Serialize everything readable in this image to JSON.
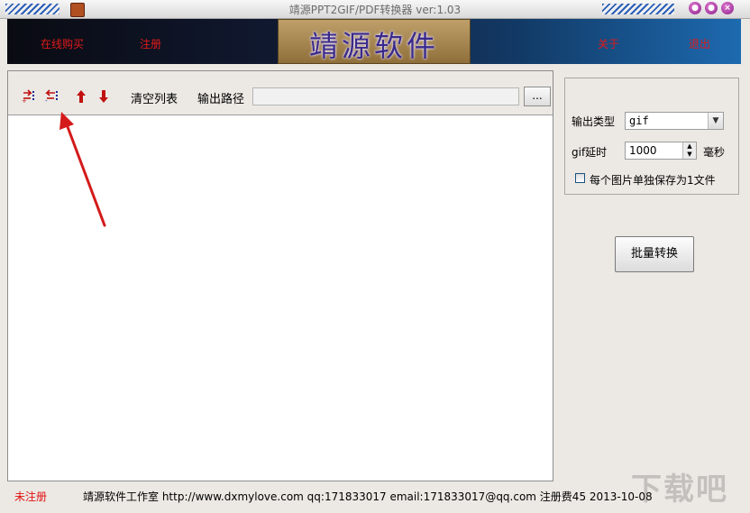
{
  "window": {
    "title": "靖源PPT2GIF/PDF转换器 ver:1.03",
    "min_glyph": "●",
    "max_glyph": "●",
    "close_glyph": "×"
  },
  "banner": {
    "buy_online": "在线购买",
    "register": "注册",
    "logo": "靖源软件",
    "about": "关于",
    "exit": "退出"
  },
  "toolbar": {
    "clear_list": "清空列表",
    "output_path_label": "输出路径",
    "output_path_value": "",
    "browse_label": "..."
  },
  "options": {
    "output_type_label": "输出类型",
    "output_type_value": "gif",
    "delay_label": "gif延时",
    "delay_value": "1000",
    "delay_unit": "毫秒",
    "save_each_label": "每个图片单独保存为1文件",
    "save_each_checked": false,
    "batch_convert": "批量转换"
  },
  "status": {
    "unregistered": "未注册",
    "info": "靖源软件工作室 http://www.dxmylove.com qq:171833017 email:171833017@qq.com 注册费45 2013-10-08"
  },
  "watermark": "下载吧",
  "colors": {
    "accent_red": "#e21a1a",
    "banner_dark": "#0a0b12",
    "banner_blue": "#1d6ab0"
  }
}
